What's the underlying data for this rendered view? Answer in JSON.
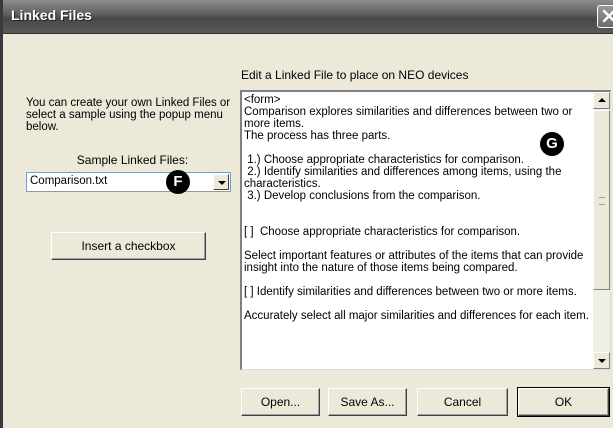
{
  "window": {
    "title": "Linked Files",
    "close_label": "close"
  },
  "left_panel": {
    "description": "You can create your own Linked Files or select a sample using the popup menu below.",
    "sample_label": "Sample Linked Files:",
    "sample_select": {
      "value": "Comparison.txt"
    },
    "insert_checkbox_label": "Insert a checkbox"
  },
  "editor": {
    "label": "Edit a Linked File to place on NEO devices",
    "content": "<form>\nComparison explores similarities and differences between two or more items.\nThe process has three parts.\n\n 1.) Choose appropriate characteristics for comparison.\n 2.) Identify similarities and differences among items, using the characteristics.\n 3.) Develop conclusions from the comparison.\n\n\n[ ]  Choose appropriate characteristics for comparison.\n\nSelect important features or attributes of the items that can provide insight into the nature of those items being compared.\n\n[ ] Identify similarities and differences between two or more items.\n\nAccurately select all major similarities and differences for each item."
  },
  "buttons": {
    "open": "Open...",
    "save_as": "Save As...",
    "cancel": "Cancel",
    "ok": "OK"
  },
  "callouts": {
    "f": "F",
    "g": "G"
  },
  "icons": {
    "close": "close-x-icon",
    "dropdown": "chevron-down-icon",
    "scroll_up": "arrow-up-icon",
    "scroll_down": "arrow-down-icon"
  }
}
